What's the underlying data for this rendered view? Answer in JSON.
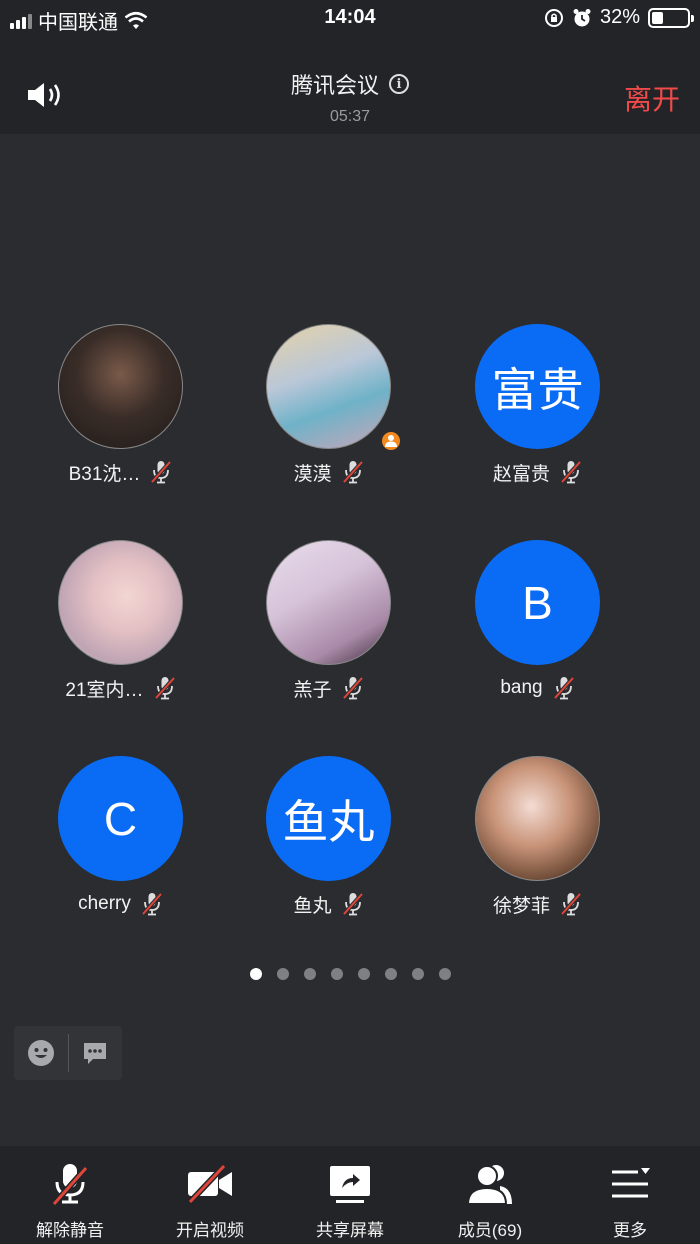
{
  "status_bar": {
    "carrier": "中国联通",
    "time": "14:04",
    "battery_percent": "32%",
    "battery_level": 0.32
  },
  "header": {
    "title": "腾讯会议",
    "duration": "05:37",
    "leave_label": "离开"
  },
  "participants": [
    {
      "name": "B31沈…",
      "avatar_type": "photo",
      "avatar_text": "",
      "muted": true,
      "host": false
    },
    {
      "name": "漠漠",
      "avatar_type": "photo",
      "avatar_text": "",
      "muted": true,
      "host": true
    },
    {
      "name": "赵富贵",
      "avatar_type": "text",
      "avatar_text": "富贵",
      "muted": true,
      "host": false
    },
    {
      "name": "21室内…",
      "avatar_type": "photo",
      "avatar_text": "",
      "muted": true,
      "host": false
    },
    {
      "name": "羔子",
      "avatar_type": "photo",
      "avatar_text": "",
      "muted": true,
      "host": false
    },
    {
      "name": "bang",
      "avatar_type": "text",
      "avatar_text": "B",
      "muted": true,
      "host": false
    },
    {
      "name": "cherry",
      "avatar_type": "text",
      "avatar_text": "C",
      "muted": true,
      "host": false
    },
    {
      "name": "鱼丸",
      "avatar_type": "text",
      "avatar_text": "鱼丸",
      "muted": true,
      "host": false
    },
    {
      "name": "徐梦菲",
      "avatar_type": "photo",
      "avatar_text": "",
      "muted": true,
      "host": false
    }
  ],
  "pagination": {
    "total": 8,
    "current": 1
  },
  "toolbar": {
    "unmute_label": "解除静音",
    "video_label": "开启视频",
    "share_label": "共享屏幕",
    "members_label": "成员(69)",
    "more_label": "更多"
  },
  "colors": {
    "background": "#2b2c30",
    "bar": "#232427",
    "accent_blue": "#0a6cf5",
    "leave_red": "#f14a4a",
    "mute_red": "#e0453a",
    "host_orange": "#f28a1f"
  },
  "icons": {
    "speaker": "speaker-icon",
    "info": "info-icon",
    "mic_muted": "mic-muted-icon",
    "video_off": "video-off-icon",
    "share_screen": "share-screen-icon",
    "members": "members-icon",
    "more": "more-icon",
    "emoji": "emoji-icon",
    "chat": "chat-icon"
  }
}
